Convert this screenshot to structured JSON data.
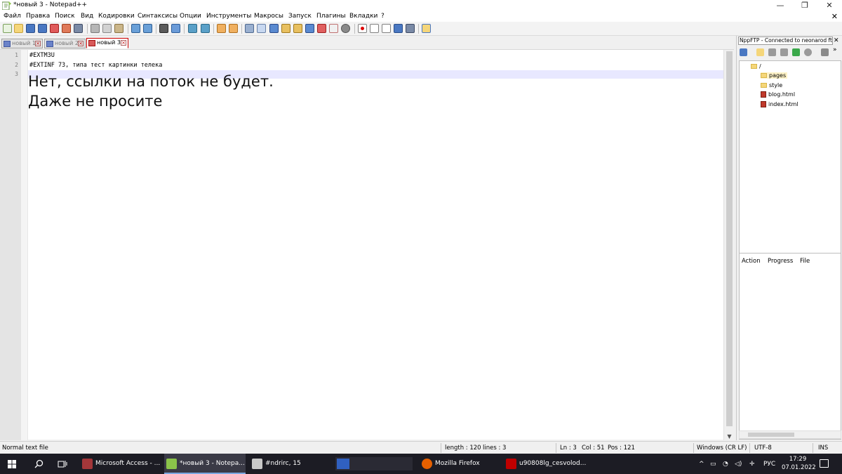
{
  "window": {
    "title": "*новый 3 - Notepad++"
  },
  "menu": [
    "Файл",
    "Правка",
    "Поиск",
    "Вид",
    "Кодировки",
    "Синтаксисы",
    "Опции",
    "Инструменты",
    "Макросы",
    "Запуск",
    "Плагины",
    "Вкладки",
    "?"
  ],
  "tabs": [
    {
      "label": "новый 1",
      "active": false
    },
    {
      "label": "новый 2",
      "active": false
    },
    {
      "label": "новый 3",
      "active": true
    }
  ],
  "editor": {
    "line_numbers": [
      "1",
      "2",
      "3"
    ],
    "lines": [
      "#EXTM3U",
      "#EXTINF 73, типа тест картинки телека"
    ],
    "overlay_text": [
      "Нет, ссылки на поток не будет.",
      "Даже не просите"
    ]
  },
  "ftp": {
    "title": "NppFTP - Connected to neonarod ftp",
    "tree": {
      "root": "/",
      "items": [
        "pages",
        "style",
        "blog.html",
        "index.html"
      ]
    },
    "columns": [
      "Action",
      "Progress",
      "File"
    ]
  },
  "status": {
    "type": "Normal text file",
    "length": "length : 120",
    "lines": "lines : 3",
    "ln": "Ln : 3",
    "col": "Col : 51",
    "pos": "Pos : 121",
    "eol": "Windows (CR LF)",
    "encoding": "UTF-8",
    "mode": "INS"
  },
  "taskbar": {
    "items": [
      "Microsoft Access - ...",
      "*новый 3 - Notepa...",
      "#ndrirc, 15",
      "Mozilla Firefox",
      "u90808lg_cesvolod..."
    ],
    "lang": "РУС",
    "time": "17:29",
    "date": "07.01.2022"
  },
  "colors": {
    "accent": "#7aa7e0",
    "taskbar_bg": "#1c1c24",
    "current_line": "#e8e8ff"
  }
}
